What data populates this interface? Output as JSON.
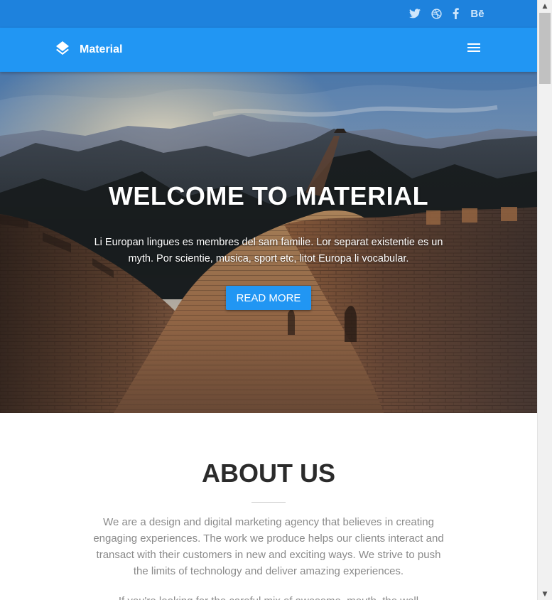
{
  "colors": {
    "topbar": "#1e82dd",
    "navbar": "#2196f3",
    "accent": "#2196f3",
    "heading": "#2b2b2b",
    "body_text": "#8a8a8a"
  },
  "topbar": {
    "social_links": [
      {
        "icon": "twitter-icon"
      },
      {
        "icon": "dribbble-icon"
      },
      {
        "icon": "facebook-icon"
      },
      {
        "icon": "behance-icon",
        "label": "Bē"
      }
    ]
  },
  "navbar": {
    "brand_icon": "layers-icon",
    "brand_name": "Material",
    "menu_icon": "hamburger-menu-icon"
  },
  "hero": {
    "title": "WELCOME TO MATERIAL",
    "text": "Li Europan lingues es membres del sam familie. Lor separat existentie es un myth. Por scientie, musica, sport etc, litot Europa li vocabular.",
    "button_label": "READ MORE"
  },
  "about": {
    "title": "ABOUT US",
    "paragraph1": "We are a design and digital marketing agency that believes in creating engaging experiences. The work we produce helps our clients interact and transact with their customers in new and exciting ways. We strive to push the limits of technology and deliver amazing experiences.",
    "paragraph2": "If you're looking for the careful mix of awesome, mouth, the well established"
  },
  "scrollbar": {
    "up_arrow": "▲",
    "down_arrow": "▼"
  }
}
